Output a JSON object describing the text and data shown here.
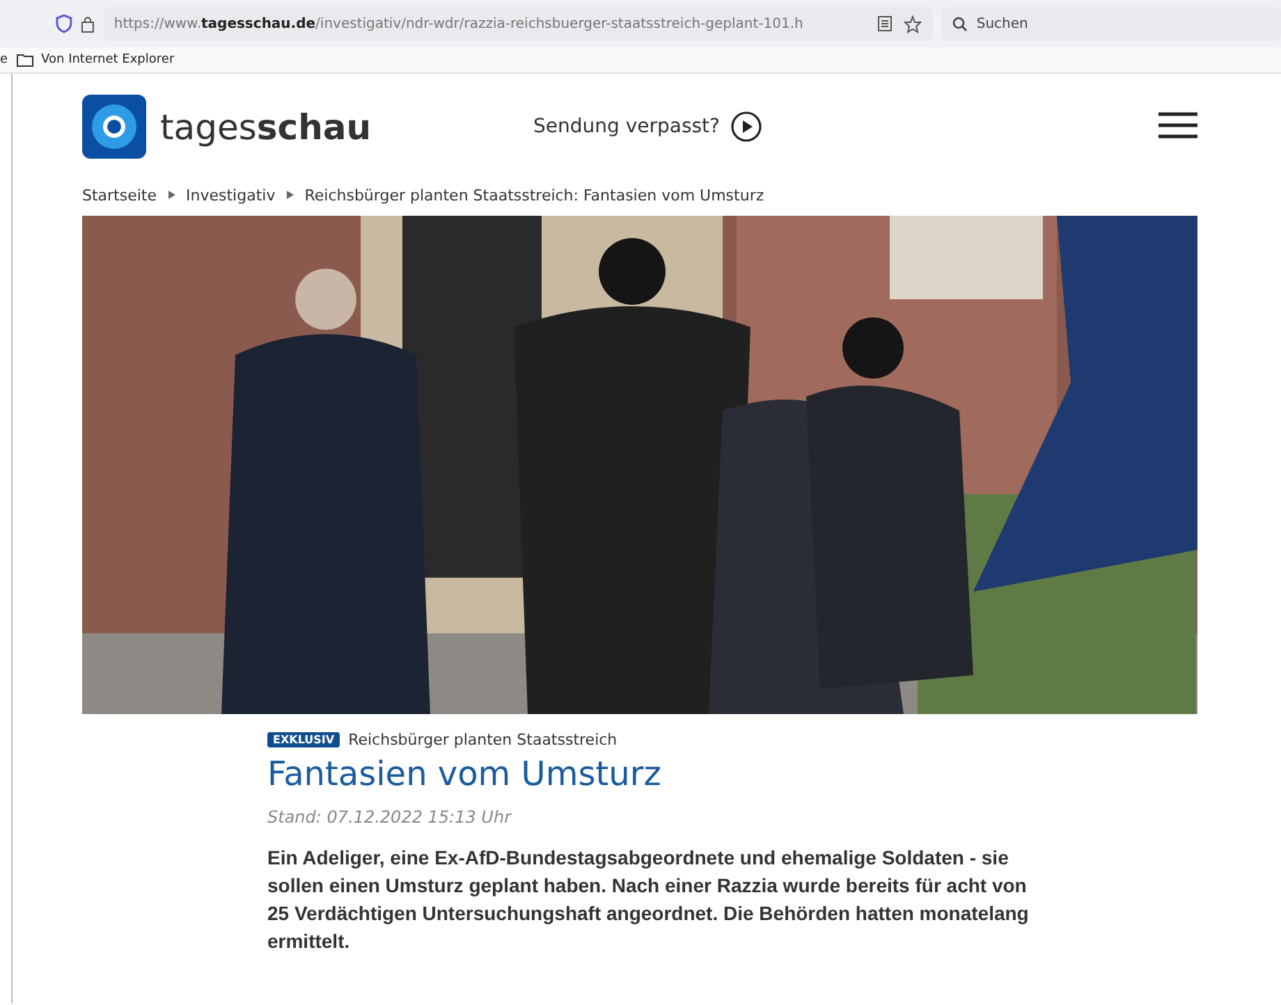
{
  "browser": {
    "url": "https://www.**tagesschau.de**/investigativ/ndr-wdr/razzia-reichsbuerger-staatsstreich-geplant-101.h",
    "search_placeholder": "Suchen",
    "bookmarks": [
      "e",
      "Von Internet Explorer"
    ]
  },
  "header": {
    "logo_text": "tages**schau**",
    "missed_show": "Sendung verpasst?"
  },
  "breadcrumbs": [
    "Startseite",
    "Investigativ",
    "Reichsbürger planten Staatsstreich: Fantasien vom Umsturz"
  ],
  "article": {
    "badge": "EXKLUSIV",
    "topline": "Reichsbürger planten Staatsstreich",
    "title": "Fantasien vom Umsturz",
    "date": "Stand: 07.12.2022 15:13 Uhr",
    "teaser": "Ein Adeliger, eine Ex-AfD-Bundestagsabgeordnete und ehemalige Soldaten - sie sollen einen Umsturz geplant haben. Nach einer Razzia wurde bereits für acht von 25 Verdächtigen Untersuchungshaft angeordnet. Die Behörden hatten monatelang ermittelt."
  }
}
